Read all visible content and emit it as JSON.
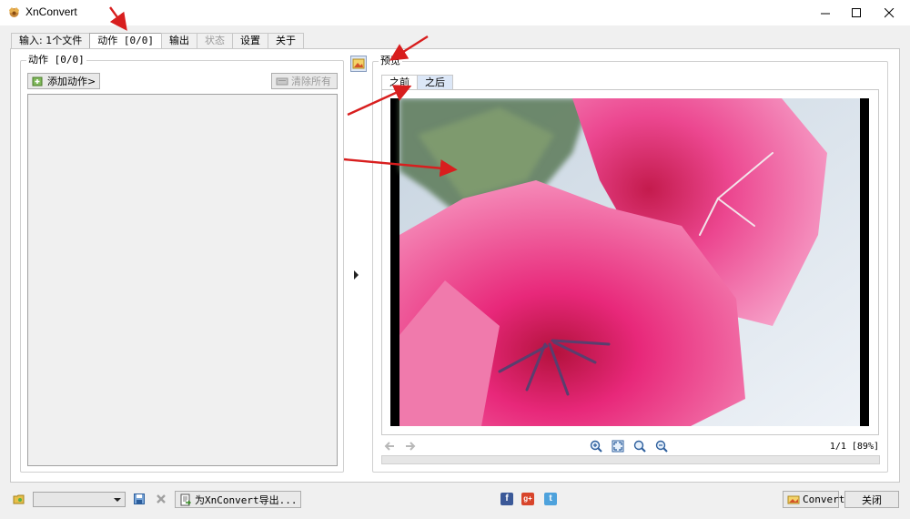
{
  "window": {
    "title": "XnConvert"
  },
  "tabs": [
    {
      "label": "输入: 1个文件"
    },
    {
      "label": "动作 [0/0]"
    },
    {
      "label": "输出"
    },
    {
      "label": "状态"
    },
    {
      "label": "设置"
    },
    {
      "label": "关于"
    }
  ],
  "actions_panel": {
    "group_label": "动作 [0/0]",
    "add_action_label": "添加动作>",
    "clear_all_label": "清除所有"
  },
  "preview_panel": {
    "group_label": "预览",
    "subtab_before": "之前",
    "subtab_after": "之后",
    "page_info": "1/1 [89%]"
  },
  "bottom_bar": {
    "export_label": "为XnConvert导出...",
    "convert_label": "Convert",
    "close_label": "关闭"
  },
  "icons": {
    "app": "xnconvert-logo-icon",
    "facebook": "facebook-icon",
    "googleplus": "google-plus-icon",
    "twitter": "twitter-icon"
  },
  "colors": {
    "annotation_arrow": "#d81e1e",
    "active_subtab": "#ffffff",
    "inactive_subtab": "#dce7f7"
  }
}
